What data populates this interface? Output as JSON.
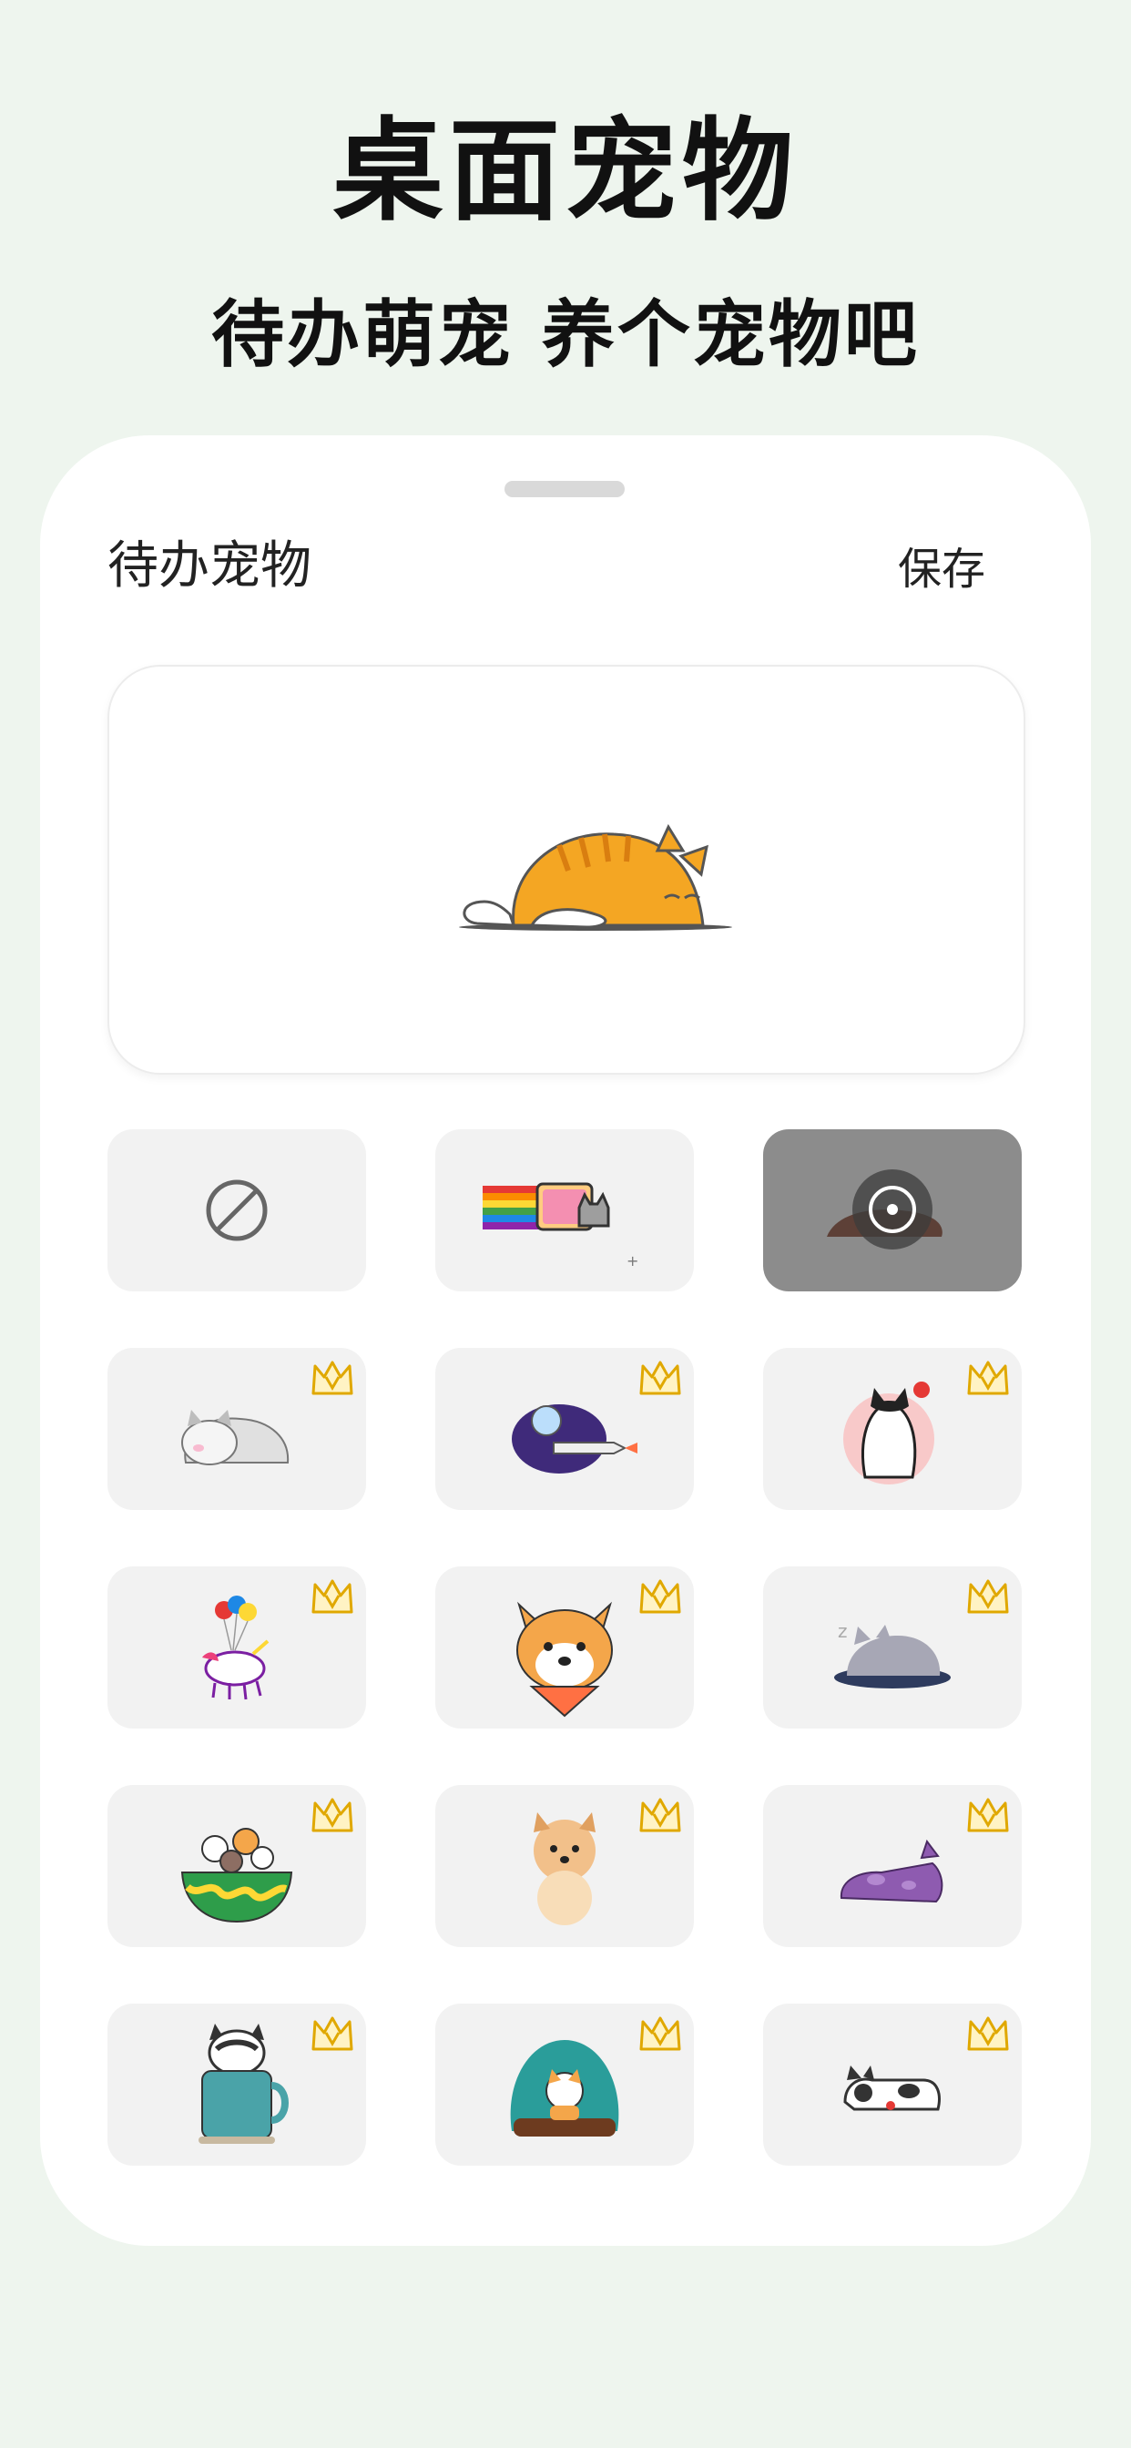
{
  "hero": {
    "title": "桌面宠物",
    "subtitle": "待办萌宠 养个宠物吧"
  },
  "sheet": {
    "title": "待办宠物",
    "save_label": "保存"
  },
  "preview": {
    "pet": "sleeping-orange-cat"
  },
  "colors": {
    "background": "#eef5ee",
    "tile": "#f2f2f2",
    "selected_tile": "#8c8c8c",
    "crown": "#f5c518"
  },
  "pets": [
    {
      "id": "none",
      "icon": "no-pet-icon",
      "premium": false,
      "selected": false
    },
    {
      "id": "nyan-cat",
      "icon": "rainbow-cat-icon",
      "premium": false,
      "selected": false
    },
    {
      "id": "sleeping-cat",
      "icon": "sleeping-cat-icon",
      "premium": false,
      "selected": true
    },
    {
      "id": "gray-kitten",
      "icon": "gray-kitten-icon",
      "premium": true,
      "selected": false
    },
    {
      "id": "space-planet",
      "icon": "rocket-planet-icon",
      "premium": true,
      "selected": false
    },
    {
      "id": "black-white-cat",
      "icon": "black-white-cat-icon",
      "premium": true,
      "selected": false
    },
    {
      "id": "unicorn",
      "icon": "unicorn-balloon-icon",
      "premium": true,
      "selected": false
    },
    {
      "id": "shiba",
      "icon": "shiba-dog-icon",
      "premium": true,
      "selected": false
    },
    {
      "id": "napping-gray-cat",
      "icon": "napping-gray-cat-icon",
      "premium": true,
      "selected": false
    },
    {
      "id": "bowl-pets",
      "icon": "bowl-pets-icon",
      "premium": true,
      "selected": false
    },
    {
      "id": "pomeranian",
      "icon": "pomeranian-icon",
      "premium": true,
      "selected": false
    },
    {
      "id": "purple-cat",
      "icon": "purple-cat-icon",
      "premium": true,
      "selected": false
    },
    {
      "id": "bulldog-mug",
      "icon": "bulldog-mug-icon",
      "premium": true,
      "selected": false
    },
    {
      "id": "globe-cat",
      "icon": "globe-cat-icon",
      "premium": true,
      "selected": false
    },
    {
      "id": "lying-dog",
      "icon": "lying-dog-icon",
      "premium": true,
      "selected": false
    }
  ]
}
